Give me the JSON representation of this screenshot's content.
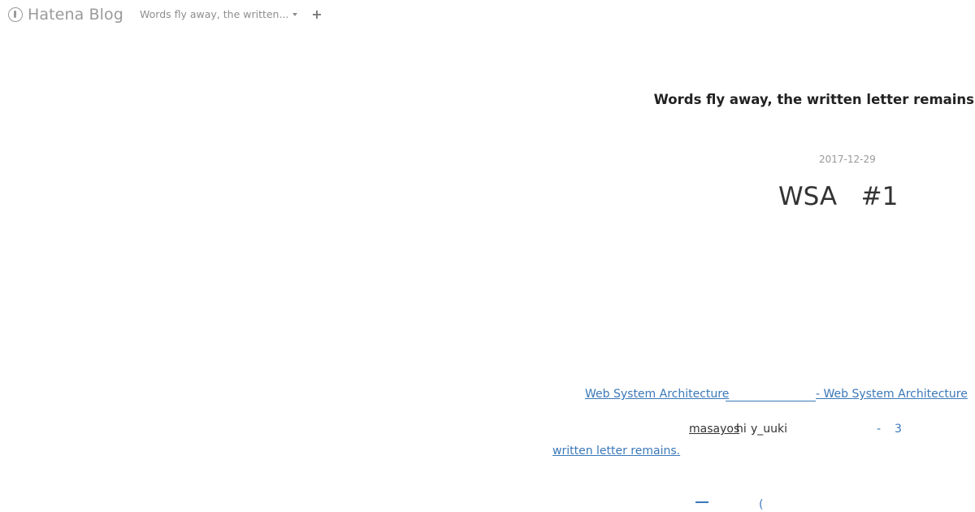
{
  "topbar": {
    "logo_text": "Hatena Blog",
    "blog_switcher_label": "Words fly away, the written...",
    "add_label": "+"
  },
  "blog": {
    "title": "Words fly away, the written letter remains"
  },
  "entry": {
    "date": "2017-12-29",
    "title": "WSA   #1",
    "links": {
      "ref_left": "Web System Architecture",
      "ref_right": "- Web System Architecture",
      "user_a1": "masayos",
      "user_a2": "hi",
      "user_b": "y_uuki",
      "dash": "-",
      "count": "3",
      "written": "written letter remains.",
      "bottom_paren": "("
    }
  },
  "colors": {
    "link": "#3b78b8",
    "muted": "#9a9a9a",
    "text": "#222222"
  }
}
